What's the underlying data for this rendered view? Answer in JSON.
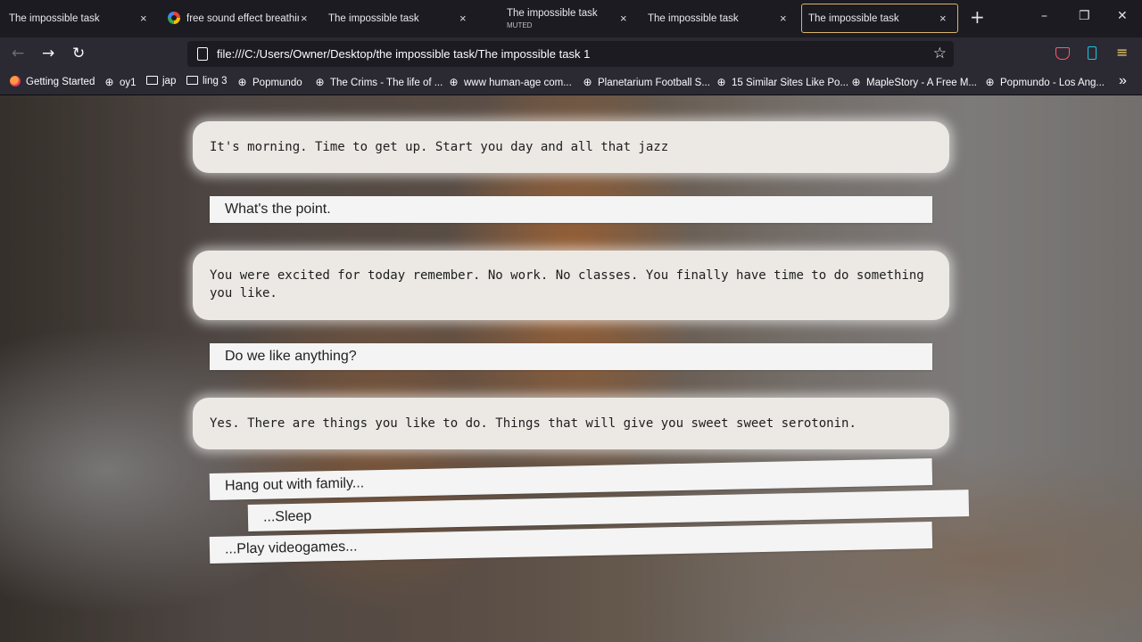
{
  "tabs": [
    {
      "title": "The impossible task",
      "close": "×"
    },
    {
      "title": "free sound effect breathin",
      "close": "×"
    },
    {
      "title": "The impossible task",
      "close": "×"
    },
    {
      "title": "The impossible task",
      "subtitle": "MUTED",
      "close": "×"
    },
    {
      "title": "The impossible task",
      "close": "×"
    },
    {
      "title": "The impossible task",
      "close": "×",
      "active": true
    }
  ],
  "window": {
    "new_tab": "+",
    "minimize": "–",
    "restore": "❐",
    "close": "✕"
  },
  "nav": {
    "back": "←",
    "forward": "→",
    "reload": "↻",
    "url": "file:///C:/Users/Owner/Desktop/the impossible task/The impossible task 1",
    "bookmark_star": "☆",
    "menu": "≡"
  },
  "bookmarks": [
    {
      "label": "Getting Started",
      "icon": "firefox-icon"
    },
    {
      "label": "oy1",
      "icon": "globe-icon"
    },
    {
      "label": "jap",
      "icon": "folder-icon"
    },
    {
      "label": "ling 3",
      "icon": "folder-icon"
    },
    {
      "label": "Popmundo",
      "icon": "globe-icon"
    },
    {
      "label": "The Crims - The life of ...",
      "icon": "globe-icon"
    },
    {
      "label": "www human-age com...",
      "icon": "globe-icon"
    },
    {
      "label": "Planetarium Football S...",
      "icon": "globe-icon"
    },
    {
      "label": "15 Similar Sites Like Po...",
      "icon": "globe-icon"
    },
    {
      "label": "MapleStory - A Free M...",
      "icon": "globe-icon"
    },
    {
      "label": "Popmundo - Los Ang...",
      "icon": "globe-icon"
    }
  ],
  "bookmarks_overflow": "»",
  "story": {
    "narration_1": "It's morning. Time to get up. Start you day and all that jazz",
    "reply_1": "What's the point.",
    "narration_2": "You were excited for today remember. No work. No classes. You finally have time to do something you like.",
    "reply_2": "Do we like anything?",
    "narration_3": "Yes. There are things you like to do. Things that will give you sweet sweet serotonin.",
    "options": [
      "Hang out with family...",
      "...Sleep",
      "...Play videogames..."
    ]
  }
}
